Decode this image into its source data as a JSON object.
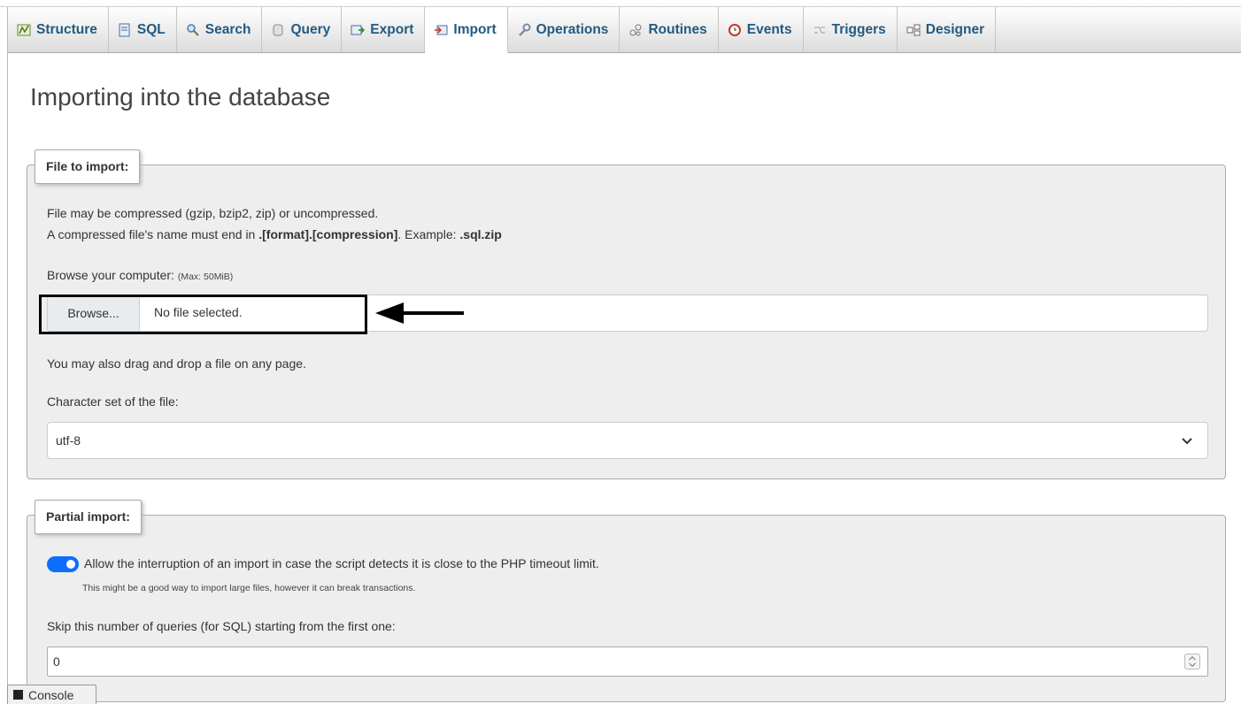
{
  "tabs": [
    {
      "label": "Structure",
      "icon": "structure-icon"
    },
    {
      "label": "SQL",
      "icon": "sql-icon"
    },
    {
      "label": "Search",
      "icon": "search-icon"
    },
    {
      "label": "Query",
      "icon": "query-icon"
    },
    {
      "label": "Export",
      "icon": "export-icon"
    },
    {
      "label": "Import",
      "icon": "import-icon"
    },
    {
      "label": "Operations",
      "icon": "wrench-icon"
    },
    {
      "label": "Routines",
      "icon": "routines-icon"
    },
    {
      "label": "Events",
      "icon": "clock-icon"
    },
    {
      "label": "Triggers",
      "icon": "triggers-icon"
    },
    {
      "label": "Designer",
      "icon": "designer-icon"
    }
  ],
  "active_tab": "Import",
  "page": {
    "title": "Importing into the database"
  },
  "file_section": {
    "legend": "File to import:",
    "line1": "File may be compressed (gzip, bzip2, zip) or uncompressed.",
    "line2_prefix": "A compressed file's name must end in ",
    "line2_format": ".[format].[compression]",
    "line2_mid": ". Example: ",
    "line2_example": ".sql.zip",
    "browse_label": "Browse your computer:",
    "browse_max": "(Max: 50MiB)",
    "browse_button": "Browse...",
    "no_file": "No file selected.",
    "drag_hint": "You may also drag and drop a file on any page.",
    "charset_label": "Character set of the file:",
    "charset_value": "utf-8"
  },
  "partial_section": {
    "legend": "Partial import:",
    "allow_interrupt_label": "Allow the interruption of an import in case the script detects it is close to the PHP timeout limit.",
    "allow_interrupt_checked": true,
    "allow_interrupt_hint": "This might be a good way to import large files, however it can break transactions.",
    "skip_label": "Skip this number of queries (for SQL) starting from the first one:",
    "skip_value": "0"
  },
  "console": {
    "label": "Console"
  },
  "colors": {
    "tab_text": "#235a81",
    "toggle": "#0d6efd",
    "panel_bg": "#eeeeee"
  }
}
